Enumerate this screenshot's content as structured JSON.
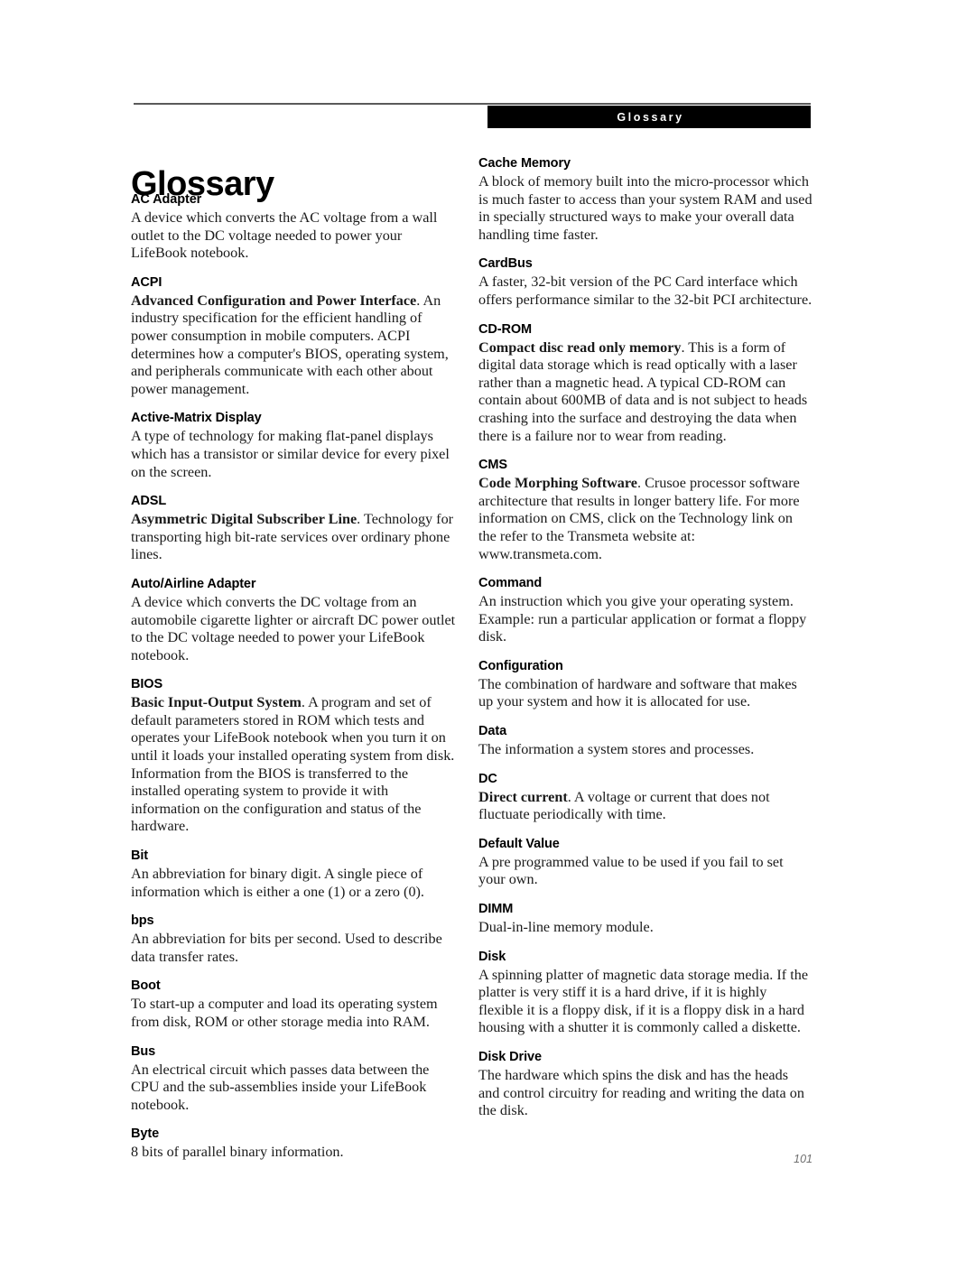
{
  "header": {
    "running_head": "Glossary"
  },
  "page_title": "Glossary",
  "footer": {
    "page_number": "101"
  },
  "colors": {
    "header_bar_background": "#000000",
    "header_bar_text": "#ffffff",
    "rule": "#5a5a5a",
    "body_text": "#1a1a1a",
    "page_number_text": "#6f6f6f",
    "page_background": "#ffffff"
  },
  "columns": {
    "left": [
      {
        "term": "AC Adapter",
        "lead": "",
        "definition": "A device which converts the AC voltage from a wall outlet to the DC voltage needed to power your LifeBook notebook."
      },
      {
        "term": "ACPI",
        "lead": "Advanced Configuration and Power Interface",
        "definition": ". An industry specification for the efficient handling of power consumption in mobile computers. ACPI determines how a computer's BIOS, operating system, and peripherals communicate with each other about power management."
      },
      {
        "term": "Active-Matrix Display",
        "lead": "",
        "definition": "A type of technology for making flat-panel displays which has a transistor or similar device for every pixel on the screen."
      },
      {
        "term": "ADSL",
        "lead": "Asymmetric Digital Subscriber Line",
        "definition": ". Technology for transporting high bit-rate services over ordinary phone lines."
      },
      {
        "term": "Auto/Airline Adapter",
        "lead": "",
        "definition": "A device which converts the DC voltage from an automobile cigarette lighter or aircraft DC power outlet to the DC voltage needed to power your LifeBook notebook."
      },
      {
        "term": "BIOS",
        "lead": "Basic Input-Output System",
        "definition": ". A program and set of default parameters stored in ROM which tests and operates your LifeBook notebook when you turn it on until it loads your installed operating system from disk. Information from the BIOS is transferred to the installed operating system to provide it with information on the configuration and status of the hardware."
      },
      {
        "term": "Bit",
        "lead": "",
        "definition": "An abbreviation for binary digit. A single piece of information which is either a one (1) or a zero (0)."
      },
      {
        "term": "bps",
        "lead": "",
        "definition": "An abbreviation for bits per second. Used to describe data transfer rates."
      },
      {
        "term": "Boot",
        "lead": "",
        "definition": "To start-up a computer and load its operating system from disk, ROM or other storage media into RAM."
      },
      {
        "term": "Bus",
        "lead": "",
        "definition": "An electrical circuit which passes data between the CPU and the sub-assemblies inside your LifeBook notebook."
      },
      {
        "term": "Byte",
        "lead": "",
        "definition": "8 bits of parallel binary information."
      }
    ],
    "right": [
      {
        "term": "Cache Memory",
        "lead": "",
        "definition": "A block of memory built into the micro-processor which is much faster to access than your system RAM and used in specially structured ways to make your overall data handling time faster."
      },
      {
        "term": "CardBus",
        "lead": "",
        "definition": "A faster, 32-bit version of the PC Card interface which offers performance similar to the 32-bit PCI architecture."
      },
      {
        "term": "CD-ROM",
        "lead": "Compact disc read only memory",
        "definition": ". This is a form of digital data storage which is read optically with a laser rather than a magnetic head. A typical CD-ROM can contain about 600MB of data and is not subject to heads crashing into the surface and destroying the data when there is a failure nor to wear from reading."
      },
      {
        "term": "CMS",
        "lead": "Code Morphing Software",
        "definition": ". Crusoe processor software architecture that results in longer battery life. For more information on CMS, click on the Technology link on the refer to the Transmeta website at: www.transmeta.com."
      },
      {
        "term": "Command",
        "lead": "",
        "definition": "An instruction which you give your operating system. Example: run a particular application or format a floppy disk."
      },
      {
        "term": "Configuration",
        "lead": "",
        "definition": "The combination of hardware and software that makes up your system and how it is allocated for use."
      },
      {
        "term": "Data",
        "lead": "",
        "definition": "The information a system stores and processes."
      },
      {
        "term": "DC",
        "lead": "Direct current",
        "definition": ". A voltage or current that does not fluctuate periodically with time."
      },
      {
        "term": "Default Value",
        "lead": "",
        "definition": "A pre programmed value to be used if you fail to set your own."
      },
      {
        "term": "DIMM",
        "lead": "",
        "definition": "Dual-in-line memory module."
      },
      {
        "term": "Disk",
        "lead": "",
        "definition": "A spinning platter of magnetic data storage media. If the platter is very stiff it is a hard drive, if it is highly flexible it is a floppy disk, if it is a floppy disk in a hard housing with a shutter it is commonly called a diskette."
      },
      {
        "term": "Disk Drive",
        "lead": "",
        "definition": "The hardware which spins the disk and has the heads and control circuitry for reading and writing the data on the disk."
      }
    ]
  }
}
